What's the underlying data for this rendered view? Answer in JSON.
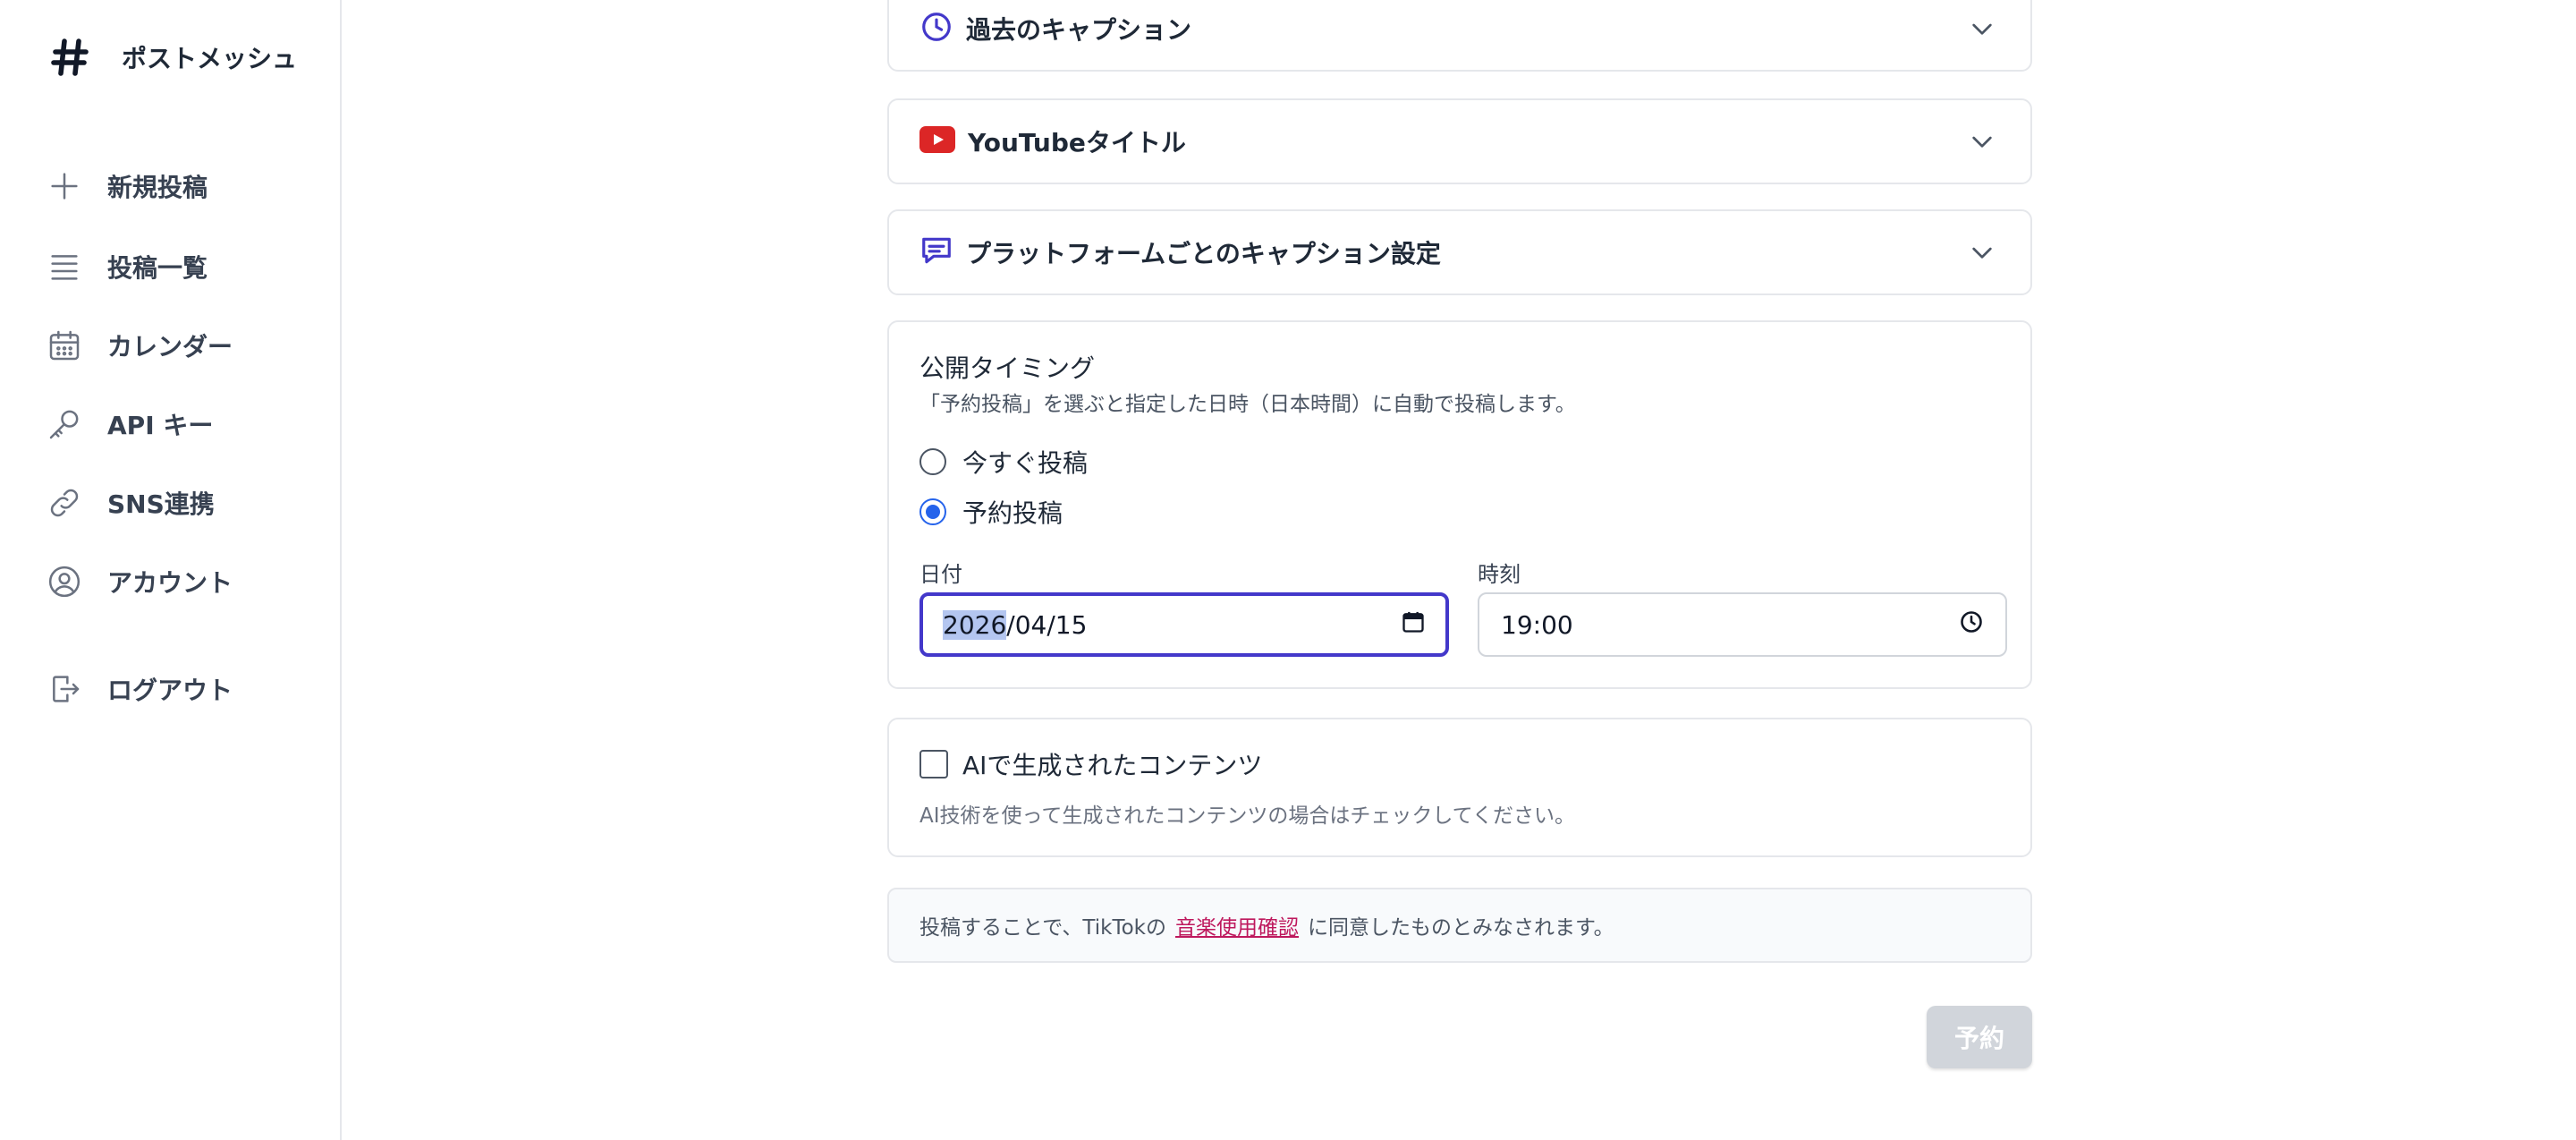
{
  "app": {
    "name": "ポストメッシュ",
    "logo_icon": "hash-icon"
  },
  "sidebar": {
    "items": [
      {
        "label": "新規投稿",
        "icon": "plus-icon"
      },
      {
        "label": "投稿一覧",
        "icon": "list-icon"
      },
      {
        "label": "カレンダー",
        "icon": "calendar-icon"
      },
      {
        "label": "API キー",
        "icon": "key-icon"
      },
      {
        "label": "SNS連携",
        "icon": "link-icon"
      },
      {
        "label": "アカウント",
        "icon": "user-circle-icon"
      },
      {
        "label": "ログアウト",
        "icon": "logout-icon"
      }
    ]
  },
  "sections": {
    "past_captions": {
      "title": "過去のキャプション",
      "icon": "clock-icon",
      "expanded": false
    },
    "youtube_title": {
      "title": "YouTubeタイトル",
      "icon": "youtube-icon",
      "expanded": false
    },
    "platform_captions": {
      "title": "プラットフォームごとのキャプション設定",
      "icon": "chat-icon",
      "expanded": false
    }
  },
  "timing": {
    "title": "公開タイミング",
    "description": "「予約投稿」を選ぶと指定した日時（日本時間）に自動で投稿します。",
    "options": [
      {
        "label": "今すぐ投稿",
        "selected": false
      },
      {
        "label": "予約投稿",
        "selected": true
      }
    ],
    "date_label": "日付",
    "date_year": "2026",
    "date_rest": "/04/15",
    "time_label": "時刻",
    "time_value": "19:00"
  },
  "ai_content": {
    "label": "AIで生成されたコンテンツ",
    "checked": false,
    "help": "AI技術を使って生成されたコンテンツの場合はチェックしてください。"
  },
  "notice": {
    "prefix": "投稿することで、TikTokの",
    "link": "音楽使用確認",
    "suffix": "に同意したものとみなされます。"
  },
  "submit": {
    "label": "予約",
    "enabled": false
  },
  "colors": {
    "accent": "#4338ca",
    "radio_selected": "#2563eb",
    "youtube_red": "#dc2626",
    "link": "#be185d",
    "submit_disabled": "#d1d5db"
  }
}
